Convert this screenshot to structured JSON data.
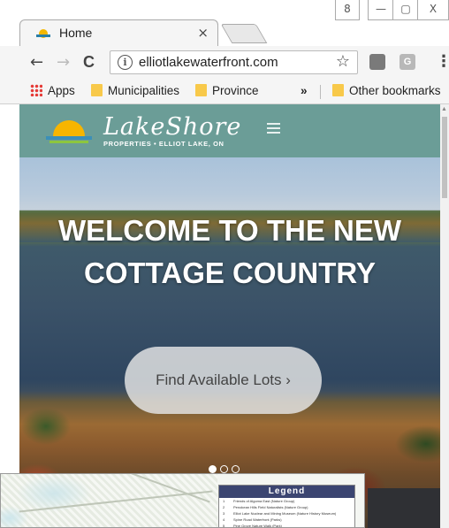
{
  "window": {
    "controls": [
      "8",
      "—",
      "▢",
      "X"
    ]
  },
  "tab": {
    "title": "Home",
    "close_glyph": "×"
  },
  "toolbar": {
    "back": "←",
    "forward": "→",
    "reload": "C",
    "url": "elliotlakewaterfront.com",
    "info_glyph": "i",
    "star_glyph": "☆",
    "ext1": "",
    "ext2": "G",
    "menu_glyph": "⋮"
  },
  "bookmarks": {
    "apps": "Apps",
    "items": [
      "Municipalities",
      "Province"
    ],
    "overflow": "»",
    "other": "Other bookmarks"
  },
  "site": {
    "logo_text": "LakeShore",
    "logo_sub": "PROPERTIES • ELLIOT LAKE, ON",
    "hero_title_line1": "WELCOME TO THE NEW",
    "hero_title_line2": "COTTAGE COUNTRY",
    "cta_label": "Find Available Lots ›",
    "carousel_active_index": 0,
    "carousel_count": 3
  },
  "map_overlay": {
    "legend_title": "Legend",
    "legend_rows": [
      {
        "num": "1",
        "text": "Friends of Algoma East (Nature Group)"
      },
      {
        "num": "2",
        "text": "Penokean Hills Field Naturalists (Nature Group)"
      },
      {
        "num": "3",
        "text": "Elliot Lake Nuclear and Mining Museum (Nature History Museum)"
      },
      {
        "num": "4",
        "text": "Spine Road Waterfront (Parks)"
      },
      {
        "num": "5",
        "text": "Pine Grove Nature Walk (Park)"
      }
    ]
  },
  "colors": {
    "header_teal": "#6b9d97",
    "legend_navy": "#3b4571",
    "folder_yellow": "#f8c94a"
  }
}
